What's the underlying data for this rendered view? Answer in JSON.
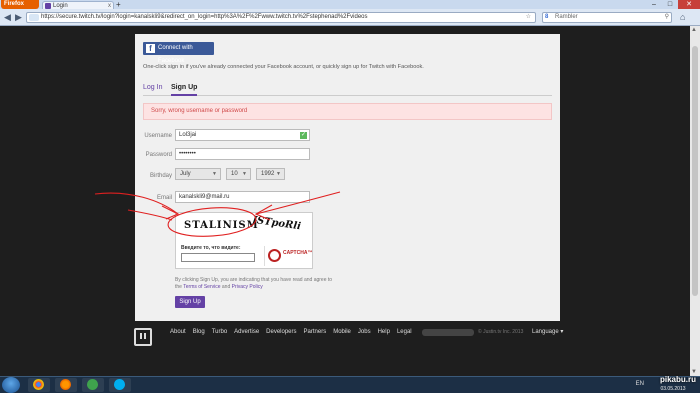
{
  "browser": {
    "app_button": "Firefox",
    "tab_title": "Login",
    "tab_close": "x",
    "new_tab": "+",
    "url": "https://secure.twitch.tv/login?login=kanalskli9&redirect_on_login=http%3A%2F%2Fwww.twitch.tv%2Fstephenad%2Fvideos",
    "search_placeholder": "Rambler",
    "search_engine_glyph": "8",
    "window_controls": {
      "minimize": "–",
      "maximize": "□",
      "close": "✕"
    }
  },
  "signup_page": {
    "facebook_button": "Connect with Facebook",
    "facebook_hint": "One-click sign in if you've already connected your Facebook account, or quickly sign up for Twitch with Facebook.",
    "tabs": {
      "login": "Log In",
      "signup": "Sign Up"
    },
    "error_message": "Sorry, wrong username or password",
    "fields": {
      "username_label": "Username",
      "username_value": "Lol3jai",
      "password_label": "Password",
      "password_value": "••••••••",
      "birthday_label": "Birthday",
      "birthday_month": "July",
      "birthday_day": "10",
      "birthday_year": "1992",
      "email_label": "Email",
      "email_value": "kanalskli9@mail.ru"
    },
    "captcha": {
      "word1": "STALINISM",
      "word2": "JSTpoRli",
      "input_label": "Введите то, что видите:",
      "brand": "CAPTCHA™"
    },
    "terms": {
      "prefix": "By clicking Sign Up, you are indicating that you have read and agree to the",
      "tos": "Terms of Service",
      "and": "and",
      "privacy": "Privacy Policy"
    },
    "signup_button": "Sign Up"
  },
  "footer": {
    "links": [
      "About",
      "Blog",
      "Turbo",
      "Advertise",
      "Developers",
      "Partners",
      "Mobile",
      "Jobs",
      "Help",
      "Legal"
    ],
    "copyright": "© Justin.tv Inc. 2013",
    "language": "Language ▾"
  },
  "taskbar": {
    "tray_lang": "EN",
    "clock_line2": "03.05.2013"
  },
  "watermark": "pikabu.ru",
  "colors": {
    "twitch_purple": "#6441a5",
    "facebook_blue": "#3b5998",
    "error_bg": "#fde3e3",
    "doodle_red": "#e02020"
  }
}
